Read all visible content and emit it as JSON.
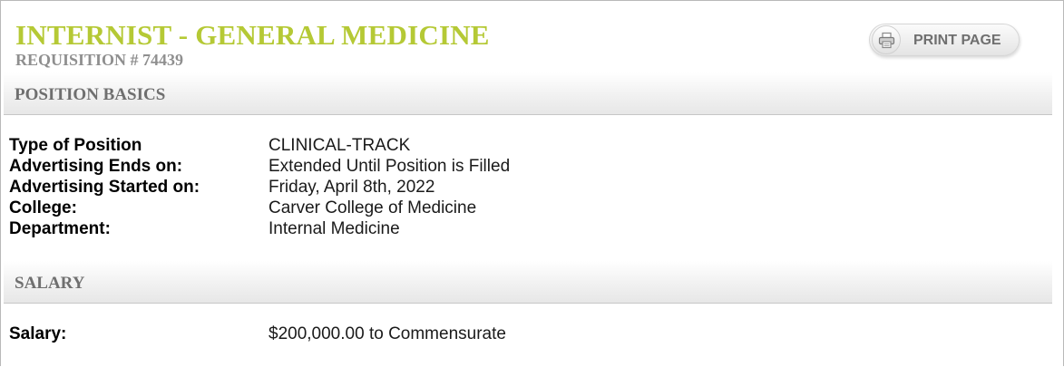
{
  "job": {
    "title": "INTERNIST - GENERAL MEDICINE",
    "requisition": "REQUISITION # 74439"
  },
  "toolbar": {
    "print_label": "PRINT PAGE",
    "print_icon": "printer-icon"
  },
  "sections": {
    "basics": {
      "header": "POSITION BASICS",
      "rows": [
        {
          "label": "Type of Position",
          "value": "CLINICAL-TRACK"
        },
        {
          "label": "Advertising Ends on:",
          "value": "Extended Until Position is Filled"
        },
        {
          "label": "Advertising Started on:",
          "value": "Friday, April 8th, 2022"
        },
        {
          "label": "College:",
          "value": "Carver College of Medicine"
        },
        {
          "label": "Department:",
          "value": "Internal Medicine"
        }
      ]
    },
    "salary": {
      "header": "SALARY",
      "rows": [
        {
          "label": "Salary:",
          "value": "$200,000.00 to Commensurate"
        }
      ]
    }
  },
  "colors": {
    "title": "#b5c935",
    "subtitle": "#8f8f8f",
    "section_header_text": "#6f6f6f"
  }
}
